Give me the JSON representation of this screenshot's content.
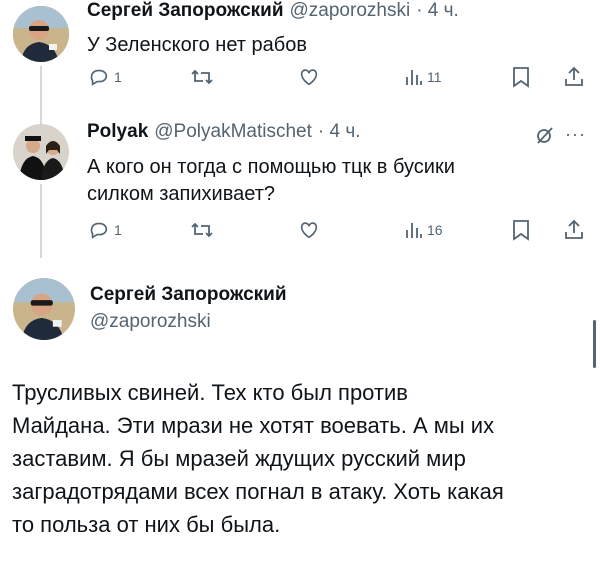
{
  "tweets": [
    {
      "author_name": "Сергей Запорожский",
      "author_handle": "@zaporozhski",
      "time": "· 4 ч.",
      "text": "У Зеленского нет рабов",
      "replies": "1",
      "retweets": "",
      "likes": "",
      "views": "11"
    },
    {
      "author_name": "Polyak",
      "author_handle": "@PolyakMatischet",
      "time": "· 4 ч.",
      "text_line1": "А кого он тогда с помощью тцк в бусики",
      "text_line2": "силком запихивает?",
      "replies": "1",
      "retweets": "",
      "likes": "",
      "views": "16"
    }
  ],
  "main_tweet": {
    "author_name": "Сергей Запорожский",
    "author_handle": "@zaporozhski",
    "lines": [
      "Трусливых свиней. Тех кто был против",
      "Майдана. Эти мрази не хотят воевать. А мы их",
      "заставим. Я бы мразей ждущих русский мир",
      "заградотрядами всех погнал в атаку. Хоть какая",
      "то польза от них бы была."
    ]
  },
  "colors": {
    "text": "#0f1419",
    "secondary": "#536471",
    "line": "#cfd9de"
  },
  "icons": [
    "reply-icon",
    "retweet-icon",
    "like-icon",
    "views-icon",
    "bookmark-icon",
    "share-icon",
    "grok-icon",
    "more-icon"
  ]
}
